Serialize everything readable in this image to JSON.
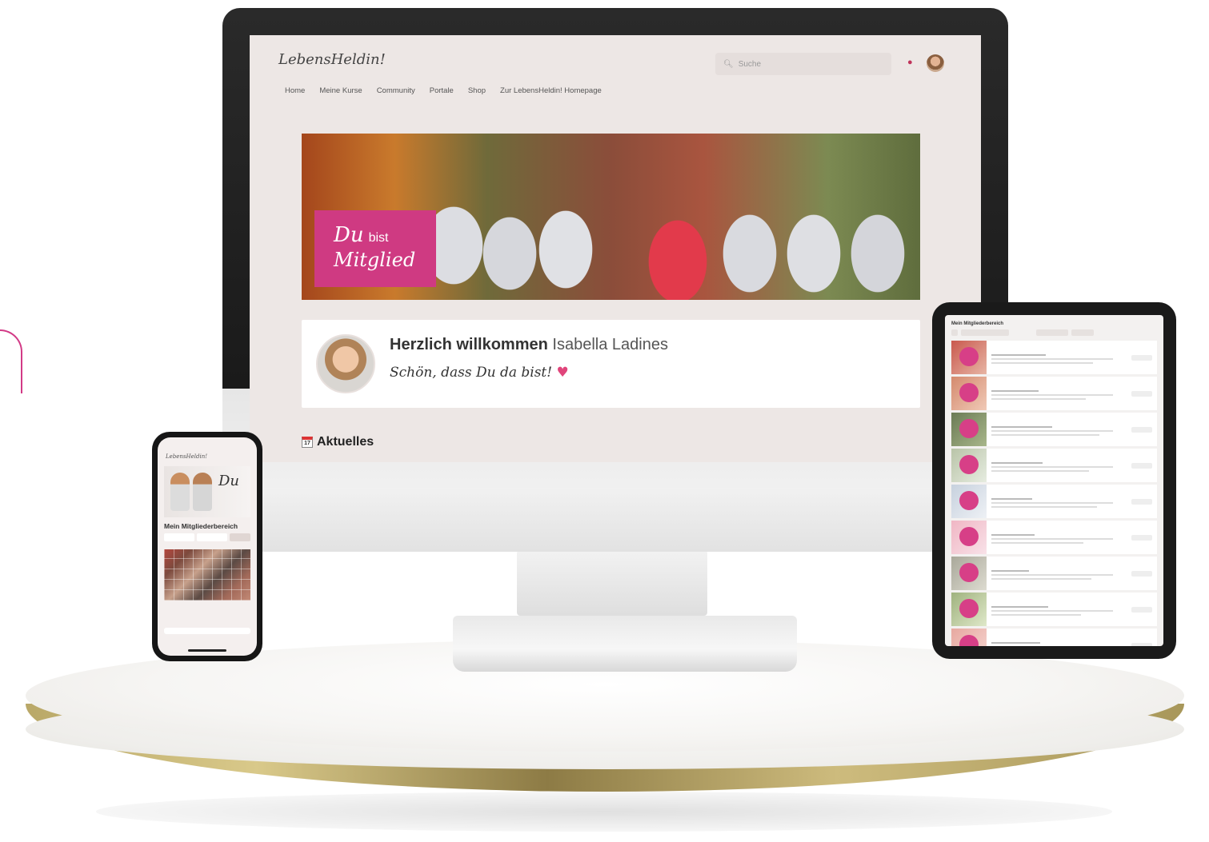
{
  "desktop": {
    "logo": "LebensHeldin!",
    "search_placeholder": "Suche",
    "nav": [
      "Home",
      "Meine Kurse",
      "Community",
      "Portale",
      "Shop",
      "Zur LebensHeldin! Homepage"
    ],
    "hero": {
      "badge_du": "Du",
      "badge_bist": "bist",
      "badge_mitglied": "Mitglied"
    },
    "welcome": {
      "greeting": "Herzlich willkommen",
      "name": "Isabella Ladines",
      "subline": "Schön, dass Du da bist!"
    },
    "section_title": "Aktuelles",
    "calendar_day": "17"
  },
  "phone": {
    "logo": "LebensHeldin!",
    "hero_script": "Du",
    "title": "Mein Mitgliederbereich"
  },
  "tablet": {
    "title": "Mein Mitgliederbereich"
  },
  "colors": {
    "accent_pink": "#cf3a82",
    "screen_bg": "#ede7e5"
  },
  "icons": [
    "search-icon",
    "bell-icon",
    "calendar-icon"
  ]
}
